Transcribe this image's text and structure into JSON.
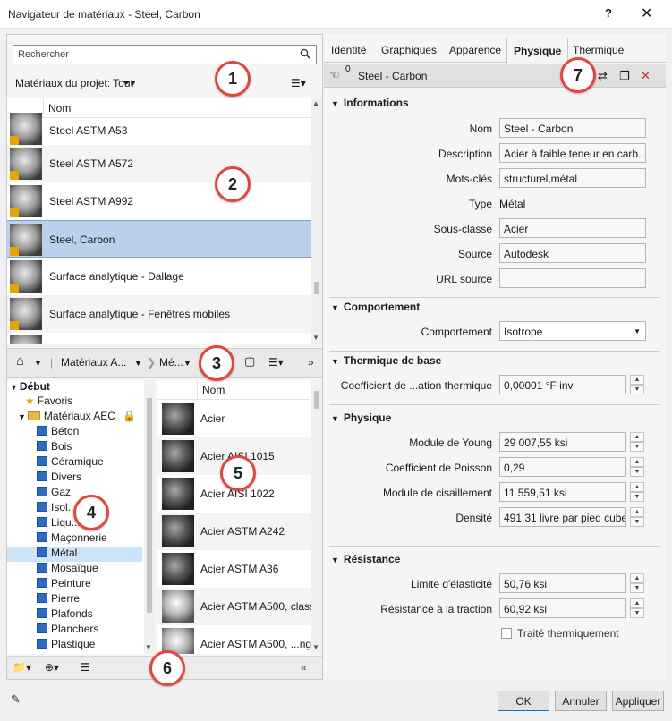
{
  "window": {
    "title": "Navigateur de matériaux - Steel, Carbon",
    "help": "?",
    "close": "✕"
  },
  "search": {
    "placeholder": "Rechercher"
  },
  "project": {
    "label": "Matériaux du projet: Tout",
    "filter": "▾"
  },
  "project_grid": {
    "column": "Nom",
    "rows": [
      {
        "label": "Steel ASTM A53"
      },
      {
        "label": "Steel ASTM A572"
      },
      {
        "label": "Steel ASTM A992"
      },
      {
        "label": "Steel, Carbon"
      },
      {
        "label": "Surface analytique - Dallage"
      },
      {
        "label": "Surface analytique - Fenêtres mobiles"
      }
    ]
  },
  "breadcrumb": {
    "home": "⌂",
    "crumb1": "Matériaux A...",
    "crumb2": "Mé...",
    "more": "»"
  },
  "tree": {
    "root": "Début",
    "favorites": "Favoris",
    "library": "Matériaux AEC",
    "items": [
      "Béton",
      "Bois",
      "Céramique",
      "Divers",
      "Gaz",
      "Isol...",
      "Liqu...",
      "Maçonnerie",
      "Métal",
      "Mosaïque",
      "Peinture",
      "Pierre",
      "Plafonds",
      "Planchers",
      "Plastique"
    ]
  },
  "library_grid": {
    "column": "Nom",
    "rows": [
      {
        "label": "Acier"
      },
      {
        "label": "Acier AISI 1015"
      },
      {
        "label": "Acier AISI 1022"
      },
      {
        "label": "Acier ASTM A242"
      },
      {
        "label": "Acier ASTM A36"
      },
      {
        "label": "Acier ASTM A500, classe"
      },
      {
        "label": "Acier ASTM A500, ...ngu"
      }
    ]
  },
  "tabs": [
    "Identité",
    "Graphiques",
    "Apparence",
    "Physique",
    "Thermique"
  ],
  "material_header": {
    "count": "0",
    "name": "Steel - Carbon"
  },
  "sections": {
    "informations": "Informations",
    "comportement": "Comportement",
    "thermique": "Thermique de base",
    "physique": "Physique",
    "resistance": "Résistance"
  },
  "info": {
    "nom_label": "Nom",
    "nom": "Steel - Carbon",
    "desc_label": "Description",
    "desc": "Acier à faible teneur en carb...",
    "mots_label": "Mots-clés",
    "mots": "structurel,métal",
    "type_label": "Type",
    "type": "Métal",
    "sousclasse_label": "Sous-classe",
    "sousclasse": "Acier",
    "source_label": "Source",
    "source": "Autodesk",
    "url_label": "URL source",
    "url": ""
  },
  "comportement": {
    "label": "Comportement",
    "value": "Isotrope"
  },
  "thermique": {
    "label": "Coefficient de ...ation thermique",
    "value": "0,00001 °F inv"
  },
  "physique": {
    "young_label": "Module de Young",
    "young": "29 007,55 ksi",
    "poisson_label": "Coefficient de Poisson",
    "poisson": "0,29",
    "cisaillement_label": "Module de cisaillement",
    "cisaillement": "11 559,51 ksi",
    "densite_label": "Densité",
    "densite": "491,31 livre par pied cube"
  },
  "resistance": {
    "elasticite_label": "Limite d'élasticité",
    "elasticite": "50,76 ksi",
    "traction_label": "Résistance à la traction",
    "traction": "60,92 ksi",
    "traite_label": "Traité thermiquement"
  },
  "buttons": {
    "ok": "OK",
    "cancel": "Annuler",
    "apply": "Appliquer"
  },
  "callouts": [
    "1",
    "2",
    "3",
    "4",
    "5",
    "6",
    "7"
  ],
  "colors": {
    "selection": "#b9d1ea",
    "callout_border": "#e0473b",
    "tree_icon": "#2e6cc2"
  }
}
